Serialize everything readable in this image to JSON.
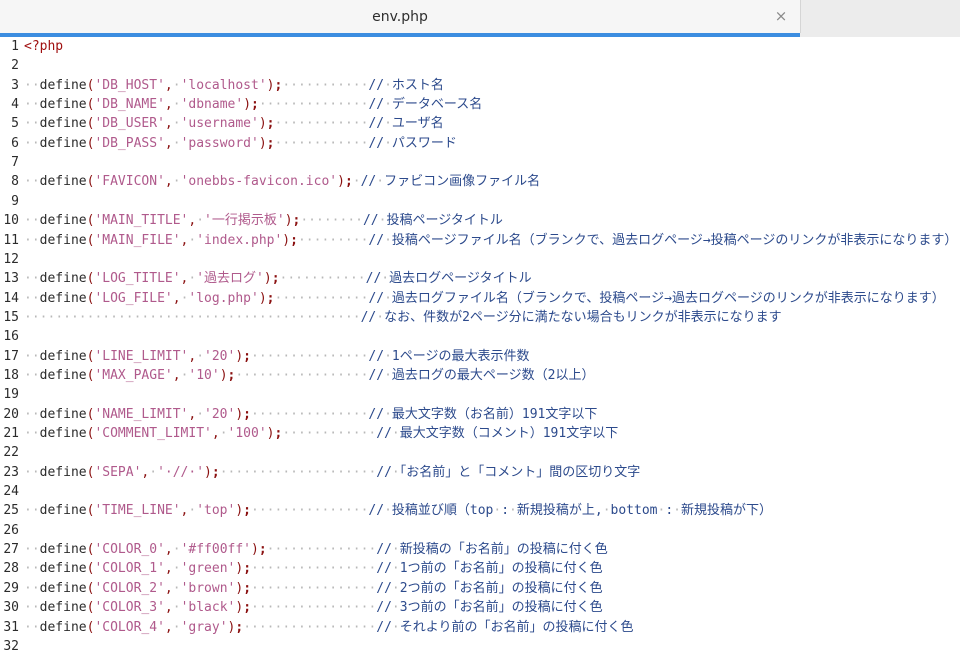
{
  "tab": {
    "title": "env.php",
    "close_glyph": "×"
  },
  "editor": {
    "lines": [
      {
        "n": "1",
        "text": "<?php"
      },
      {
        "n": "2",
        "text": ""
      },
      {
        "n": "3",
        "text": "··define('DB_HOST',·'localhost');···········//·ホスト名"
      },
      {
        "n": "4",
        "text": "··define('DB_NAME',·'dbname');··············//·データベース名"
      },
      {
        "n": "5",
        "text": "··define('DB_USER',·'username');············//·ユーザ名"
      },
      {
        "n": "6",
        "text": "··define('DB_PASS',·'password');············//·パスワード"
      },
      {
        "n": "7",
        "text": ""
      },
      {
        "n": "8",
        "text": "··define('FAVICON',·'onebbs-favicon.ico');·//·ファビコン画像ファイル名"
      },
      {
        "n": "9",
        "text": ""
      },
      {
        "n": "10",
        "text": "··define('MAIN_TITLE',·'一行掲示板');········//·投稿ページタイトル"
      },
      {
        "n": "11",
        "text": "··define('MAIN_FILE',·'index.php');·········//·投稿ページファイル名（ブランクで、過去ログページ→投稿ページのリンクが非表示になります）"
      },
      {
        "n": "12",
        "text": ""
      },
      {
        "n": "13",
        "text": "··define('LOG_TITLE',·'過去ログ');···········//·過去ログページタイトル"
      },
      {
        "n": "14",
        "text": "··define('LOG_FILE',·'log.php');············//·過去ログファイル名（ブランクで、投稿ページ→過去ログページのリンクが非表示になります）"
      },
      {
        "n": "15",
        "text": "···········································//·なお、件数が2ページ分に満たない場合もリンクが非表示になります"
      },
      {
        "n": "16",
        "text": ""
      },
      {
        "n": "17",
        "text": "··define('LINE_LIMIT',·'20');···············//·1ページの最大表示件数"
      },
      {
        "n": "18",
        "text": "··define('MAX_PAGE',·'10');·················//·過去ログの最大ページ数（2以上）"
      },
      {
        "n": "19",
        "text": ""
      },
      {
        "n": "20",
        "text": "··define('NAME_LIMIT',·'20');···············//·最大文字数（お名前）191文字以下"
      },
      {
        "n": "21",
        "text": "··define('COMMENT_LIMIT',·'100');············//·最大文字数（コメント）191文字以下"
      },
      {
        "n": "22",
        "text": ""
      },
      {
        "n": "23",
        "text": "··define('SEPA',·'·//·');····················//·「お名前」と「コメント」間の区切り文字"
      },
      {
        "n": "24",
        "text": ""
      },
      {
        "n": "25",
        "text": "··define('TIME_LINE',·'top');···············//·投稿並び順（top·:·新規投稿が上,·bottom·:·新規投稿が下）"
      },
      {
        "n": "26",
        "text": ""
      },
      {
        "n": "27",
        "text": "··define('COLOR_0',·'#ff00ff');··············//·新投稿の「お名前」の投稿に付く色"
      },
      {
        "n": "28",
        "text": "··define('COLOR_1',·'green');················//·1つ前の「お名前」の投稿に付く色"
      },
      {
        "n": "29",
        "text": "··define('COLOR_2',·'brown');················//·2つ前の「お名前」の投稿に付く色"
      },
      {
        "n": "30",
        "text": "··define('COLOR_3',·'black');················//·3つ前の「お名前」の投稿に付く色"
      },
      {
        "n": "31",
        "text": "··define('COLOR_4',·'gray');·················//·それより前の「お名前」の投稿に付く色"
      },
      {
        "n": "32",
        "text": ""
      }
    ]
  },
  "colors": {
    "accent": "#3c8de0",
    "string": "#b05a8c",
    "comment": "#2c4a8c",
    "punct": "#8a1010",
    "whitespace_dots": "#b8b8b8"
  }
}
